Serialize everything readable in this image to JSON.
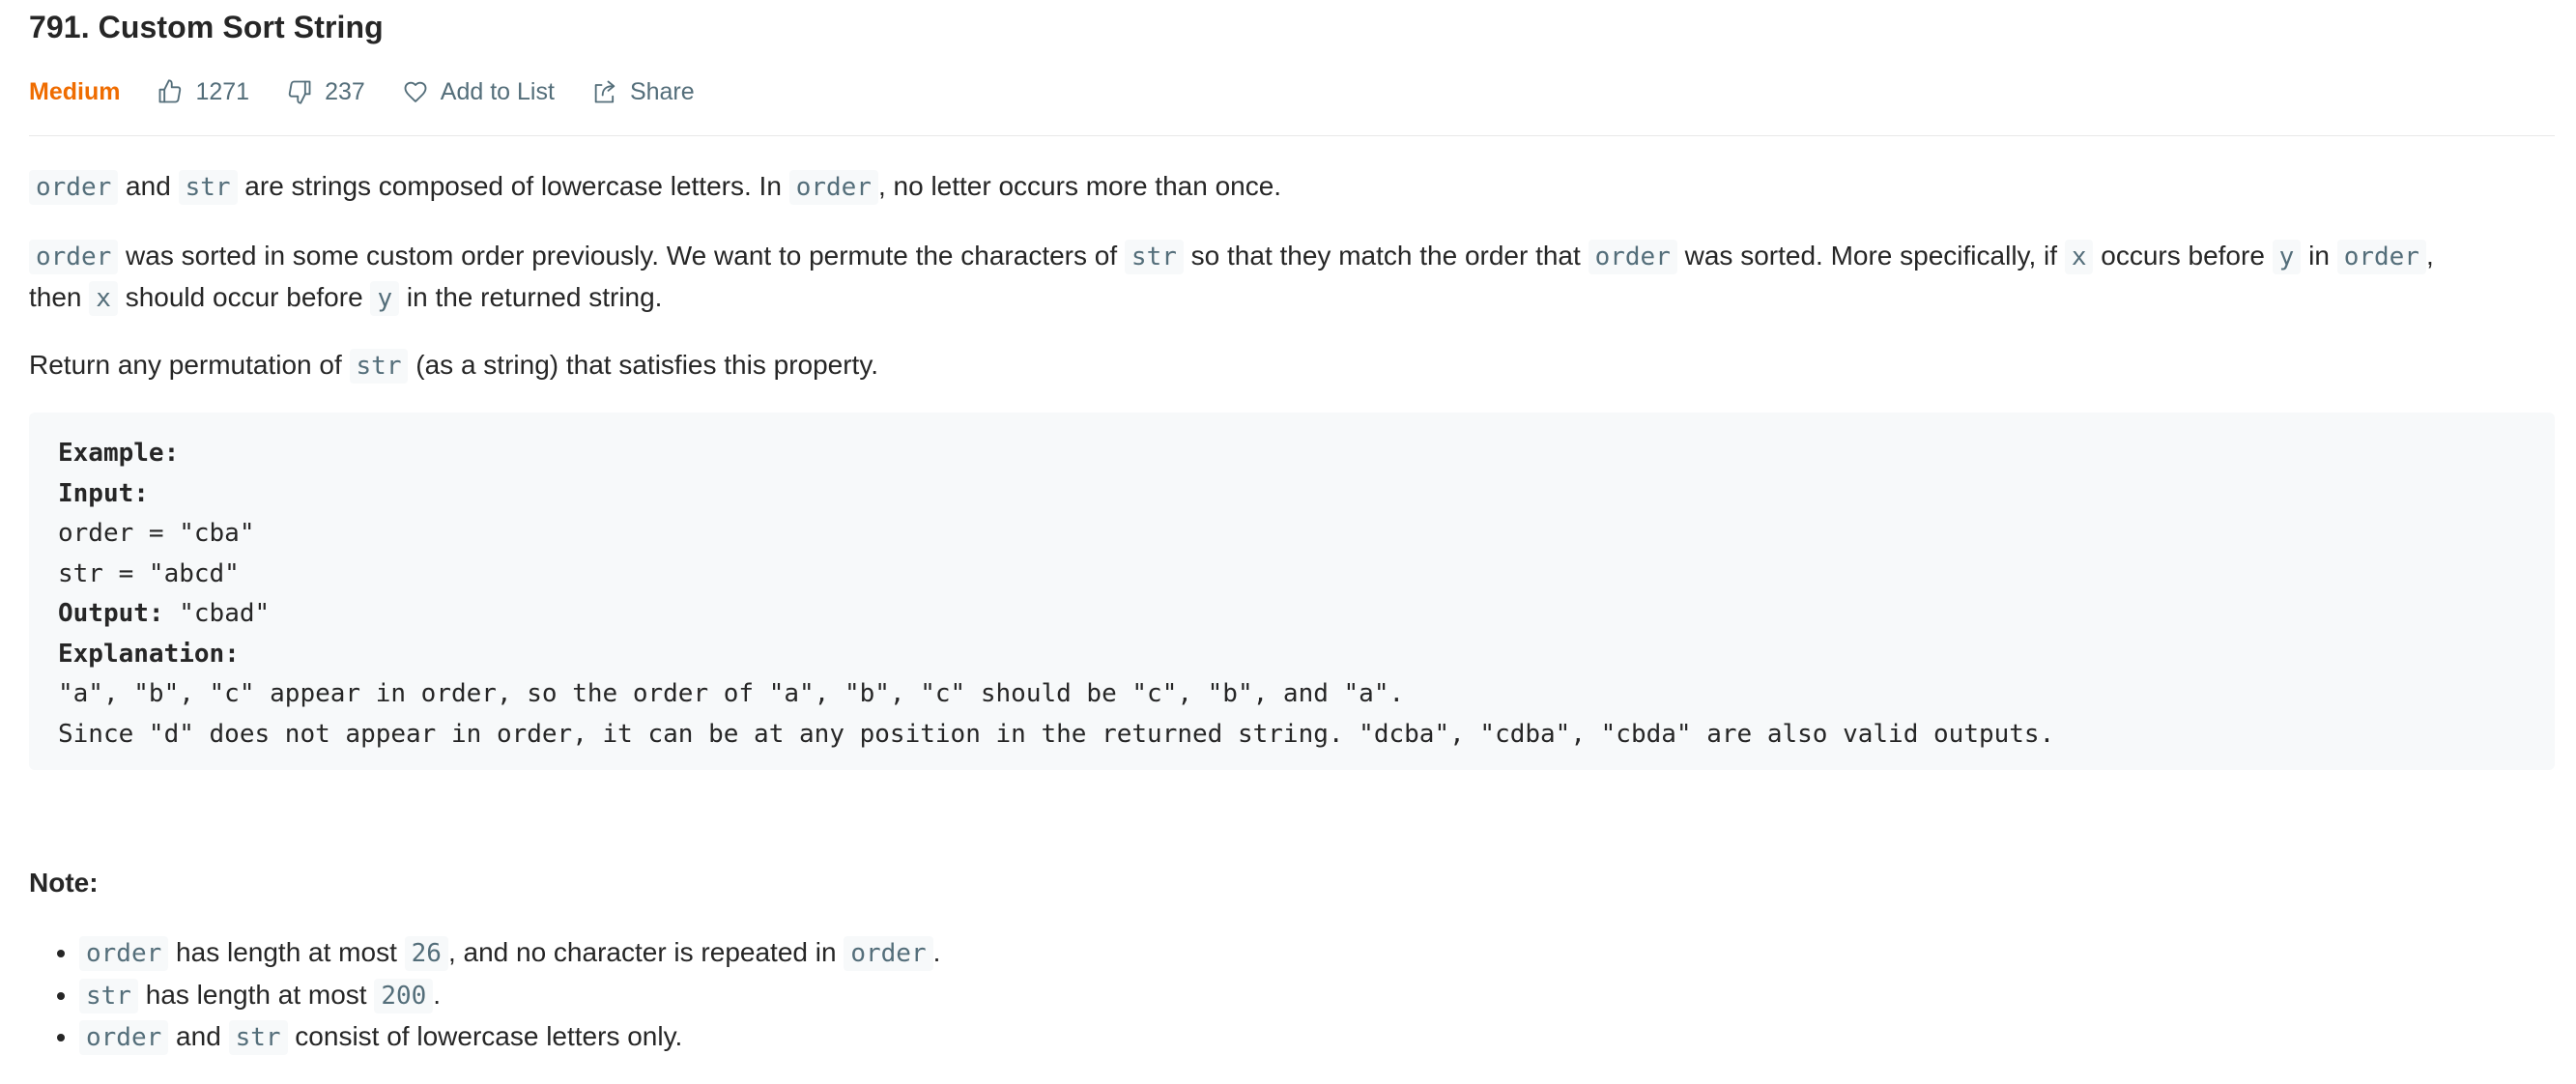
{
  "problem": {
    "title": "791. Custom Sort String",
    "difficulty": "Medium",
    "likes": "1271",
    "dislikes": "237",
    "add_to_list": "Add to List",
    "share": "Share"
  },
  "description": {
    "p1": {
      "code_order": "order",
      "t1": " and ",
      "code_str": "str",
      "t2": " are strings composed of lowercase letters. In ",
      "code_order2": "order",
      "t3": ", no letter occurs more than once."
    },
    "p2": {
      "code_order": "order",
      "t1": " was sorted in some custom order previously. We want to permute the characters of ",
      "code_str": "str",
      "t2": " so that they match the order that ",
      "code_order2": "order",
      "t3": " was sorted. More specifically, if ",
      "code_x": "x",
      "t4": " occurs before ",
      "code_y": "y",
      "t5": " in ",
      "code_order3": "order",
      "t6": ",",
      "t7": "then ",
      "code_x2": "x",
      "t8": " should occur before ",
      "code_y2": "y",
      "t9": " in the returned string."
    },
    "p3": {
      "t1": "Return any permutation of ",
      "code_str": "str",
      "t2": " (as a string) that satisfies this property."
    }
  },
  "example": {
    "heading": "Example:",
    "input_label": "Input:",
    "input_line1": "order = \"cba\"",
    "input_line2": "str = \"abcd\"",
    "output_label": "Output:",
    "output_value": " \"cbad\"",
    "explanation_label": "Explanation:",
    "explanation_line1": "\"a\", \"b\", \"c\" appear in order, so the order of \"a\", \"b\", \"c\" should be \"c\", \"b\", and \"a\".",
    "explanation_line2": "Since \"d\" does not appear in order, it can be at any position in the returned string. \"dcba\", \"cdba\", \"cbda\" are also valid outputs."
  },
  "note": {
    "title": "Note:",
    "items": [
      {
        "code1": "order",
        "t1": " has length at most ",
        "code2": "26",
        "t2": ", and no character is repeated in ",
        "code3": "order",
        "t3": "."
      },
      {
        "code1": "str",
        "t1": " has length at most ",
        "code2": "200",
        "t2": "."
      },
      {
        "code1": "order",
        "t1": " and ",
        "code2": "str",
        "t2": " consist of lowercase letters only."
      }
    ]
  },
  "colors": {
    "difficulty_medium": "#ef6c00",
    "code_text": "#546e7a",
    "code_bg": "#f7f9fa",
    "meta_text": "#546e7a"
  },
  "icons": {
    "likes": "thumbs-up-icon",
    "dislikes": "thumbs-down-icon",
    "add_to_list": "heart-icon",
    "share": "share-icon"
  }
}
